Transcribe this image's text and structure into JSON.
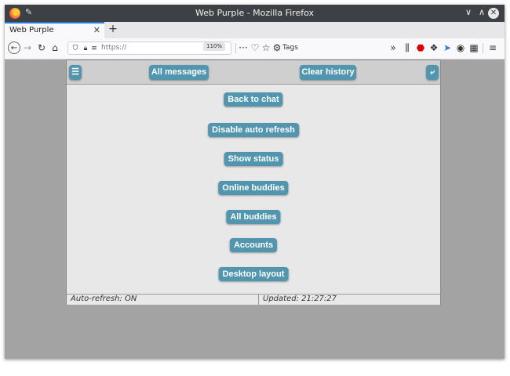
{
  "window": {
    "title": "Web Purple - Mozilla Firefox"
  },
  "tabs": [
    {
      "label": "Web Purple"
    }
  ],
  "navbar": {
    "url": "https://",
    "zoom": "110%",
    "tags_label": "Tags"
  },
  "app": {
    "menu_icon": "☰",
    "header_buttons": {
      "all_messages": "All messages",
      "clear_history": "Clear history"
    },
    "back_icon": "⤶",
    "menu_items": [
      {
        "label": "Back to chat"
      },
      {
        "label": "Disable auto refresh"
      },
      {
        "label": "Show status"
      },
      {
        "label": "Online buddies"
      },
      {
        "label": "All buddies"
      },
      {
        "label": "Accounts"
      },
      {
        "label": "Desktop layout"
      }
    ],
    "footer": {
      "auto_refresh": "Auto-refresh: ON",
      "updated": "Updated: 21:27:27"
    }
  },
  "colors": {
    "button": "#5196ae",
    "titlebar": "#3d4145",
    "background": "#a3a3a3",
    "panel": "#e8e8e8"
  }
}
